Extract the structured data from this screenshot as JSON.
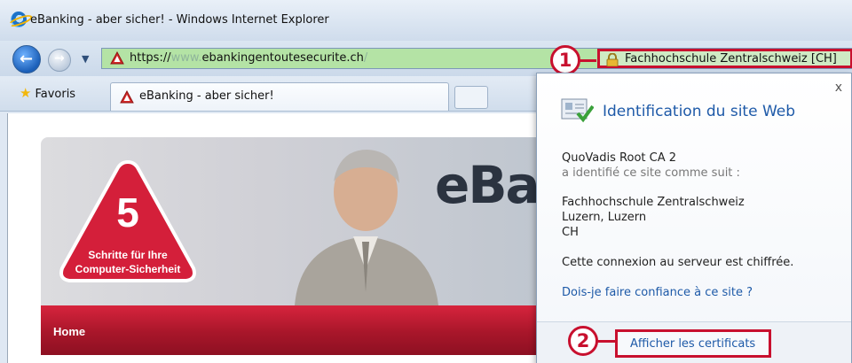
{
  "window": {
    "title": "eBanking - aber sicher! - Windows Internet Explorer"
  },
  "address_bar": {
    "url_scheme": "https://",
    "url_sub": "www.",
    "url_domain": "ebankingentoutesecurite.ch",
    "url_path": "/",
    "cert_label": "Fachhochschule Zentralschweiz [CH]"
  },
  "annotations": {
    "marker_1": "1",
    "marker_2": "2",
    "color": "#c8102e"
  },
  "favorites": {
    "label": "Favoris"
  },
  "tab": {
    "label": "eBanking - aber sicher!"
  },
  "page": {
    "banner_number": "5",
    "banner_line1": "Schritte für Ihre",
    "banner_line2": "Computer-Sicherheit",
    "logo_text": "eBa",
    "nav_home": "Home"
  },
  "popup": {
    "title": "Identification du site Web",
    "close": "x",
    "issuer": "QuoVadis Root CA 2",
    "issuer_note": "a identifié ce site comme suit :",
    "org": "Fachhochschule Zentralschweiz",
    "location": "Luzern, Luzern",
    "country": "CH",
    "encryption": "Cette connexion au serveur est chiffrée.",
    "trust_link": "Dois-je faire confiance à ce site ?",
    "cert_button": "Afficher les certificats"
  },
  "icons": [
    "ie-logo-icon",
    "back-arrow-icon",
    "forward-arrow-icon",
    "warning-icon",
    "padlock-icon",
    "star-icon",
    "site-identification-icon",
    "close-icon"
  ]
}
